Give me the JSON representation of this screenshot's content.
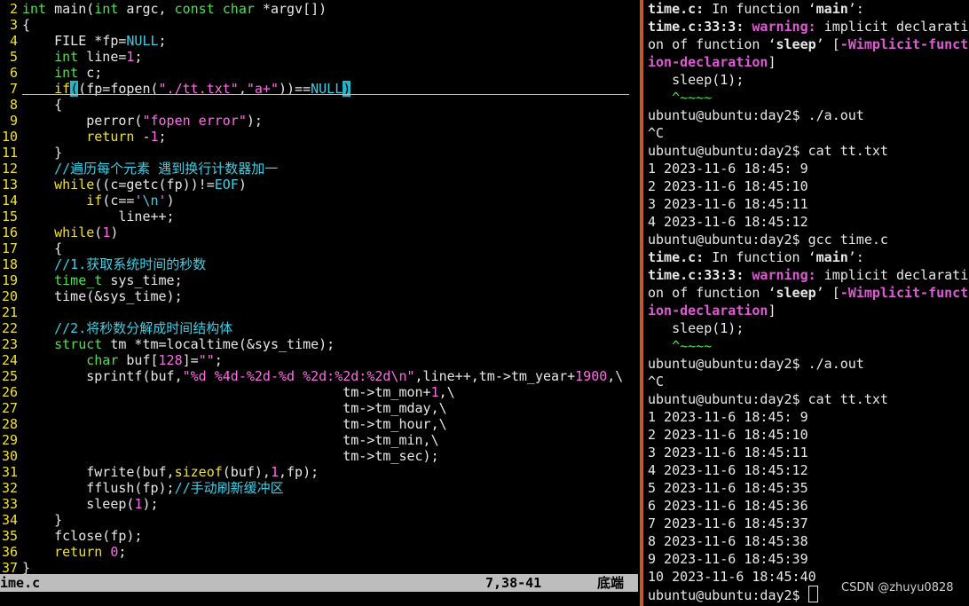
{
  "editor": {
    "file_name": "ime.c",
    "cursor_position": "7,38-41",
    "scroll_position": "底端"
  },
  "code_lines": [
    {
      "num": "2",
      "segs": [
        [
          "int",
          "t"
        ],
        [
          " main(",
          "x"
        ],
        [
          "int",
          "t"
        ],
        [
          " argc, ",
          "x"
        ],
        [
          "const",
          "t"
        ],
        [
          " ",
          "x"
        ],
        [
          "char",
          "t"
        ],
        [
          " *argv[])",
          "x"
        ]
      ]
    },
    {
      "num": "3",
      "segs": [
        [
          "{",
          "x"
        ]
      ]
    },
    {
      "num": "4",
      "segs": [
        [
          "    FILE *fp=",
          "x"
        ],
        [
          "NULL",
          "p"
        ],
        [
          ";",
          "x"
        ]
      ]
    },
    {
      "num": "5",
      "segs": [
        [
          "    ",
          "x"
        ],
        [
          "int",
          "t"
        ],
        [
          " line=",
          "x"
        ],
        [
          "1",
          "n"
        ],
        [
          ";",
          "x"
        ]
      ]
    },
    {
      "num": "6",
      "segs": [
        [
          "    ",
          "x"
        ],
        [
          "int",
          "t"
        ],
        [
          " c;",
          "x"
        ]
      ]
    },
    {
      "num": "7",
      "segs": [
        [
          "    ",
          "x"
        ],
        [
          "if",
          "k"
        ],
        [
          "(",
          "hl"
        ],
        [
          "(fp=fopen(",
          "x"
        ],
        [
          "\"./tt.txt\"",
          "s"
        ],
        [
          ",",
          "x"
        ],
        [
          "\"a+\"",
          "s"
        ],
        [
          "))==",
          "x"
        ],
        [
          "NULL",
          "p"
        ],
        [
          ")",
          "hl"
        ]
      ]
    },
    {
      "num": "8",
      "segs": [
        [
          "    {",
          "x"
        ]
      ]
    },
    {
      "num": "9",
      "segs": [
        [
          "        perror(",
          "x"
        ],
        [
          "\"fopen error\"",
          "s"
        ],
        [
          ");",
          "x"
        ]
      ]
    },
    {
      "num": "10",
      "segs": [
        [
          "        ",
          "x"
        ],
        [
          "return",
          "k"
        ],
        [
          " -",
          "x"
        ],
        [
          "1",
          "n"
        ],
        [
          ";",
          "x"
        ]
      ]
    },
    {
      "num": "11",
      "segs": [
        [
          "    }",
          "x"
        ]
      ]
    },
    {
      "num": "12",
      "segs": [
        [
          "    //遍历每个元素 遇到换行计数器加一",
          "c"
        ]
      ]
    },
    {
      "num": "13",
      "segs": [
        [
          "    ",
          "x"
        ],
        [
          "while",
          "k"
        ],
        [
          "((c=getc(fp))!=",
          "x"
        ],
        [
          "EOF",
          "p"
        ],
        [
          ")",
          "x"
        ]
      ]
    },
    {
      "num": "14",
      "segs": [
        [
          "        ",
          "x"
        ],
        [
          "if",
          "k"
        ],
        [
          "(c==",
          "x"
        ],
        [
          "'",
          "s"
        ],
        [
          "\\n",
          "p"
        ],
        [
          "'",
          "s"
        ],
        [
          ")",
          "x"
        ]
      ]
    },
    {
      "num": "15",
      "segs": [
        [
          "            line++;",
          "x"
        ]
      ]
    },
    {
      "num": "16",
      "segs": [
        [
          "    ",
          "x"
        ],
        [
          "while",
          "k"
        ],
        [
          "(",
          "x"
        ],
        [
          "1",
          "n"
        ],
        [
          ")",
          "x"
        ]
      ]
    },
    {
      "num": "17",
      "segs": [
        [
          "    {",
          "x"
        ]
      ]
    },
    {
      "num": "18",
      "segs": [
        [
          "    //1.获取系统时间的秒数",
          "c"
        ]
      ]
    },
    {
      "num": "19",
      "segs": [
        [
          "    ",
          "x"
        ],
        [
          "time_t",
          "t"
        ],
        [
          " sys_time;",
          "x"
        ]
      ]
    },
    {
      "num": "20",
      "segs": [
        [
          "    time(&sys_time);",
          "x"
        ]
      ]
    },
    {
      "num": "21",
      "segs": [
        [
          "",
          "x"
        ]
      ]
    },
    {
      "num": "22",
      "segs": [
        [
          "    //2.将秒数分解成时间结构体",
          "c"
        ]
      ]
    },
    {
      "num": "23",
      "segs": [
        [
          "    ",
          "x"
        ],
        [
          "struct",
          "t"
        ],
        [
          " tm *tm=localtime(&sys_time);",
          "x"
        ]
      ]
    },
    {
      "num": "24",
      "segs": [
        [
          "        ",
          "x"
        ],
        [
          "char",
          "t"
        ],
        [
          " buf[",
          "x"
        ],
        [
          "128",
          "n"
        ],
        [
          "]=",
          "x"
        ],
        [
          "\"\"",
          "s"
        ],
        [
          ";",
          "x"
        ]
      ]
    },
    {
      "num": "25",
      "segs": [
        [
          "        sprintf(buf,",
          "x"
        ],
        [
          "\"%d %4d-%2d-%d %2d:%2d:%2d\\n\"",
          "s"
        ],
        [
          ",line++,tm->tm_year+",
          "x"
        ],
        [
          "1900",
          "n"
        ],
        [
          ",\\",
          "x"
        ]
      ]
    },
    {
      "num": "26",
      "segs": [
        [
          "                                        tm->tm_mon+",
          "x"
        ],
        [
          "1",
          "n"
        ],
        [
          ",\\",
          "x"
        ]
      ]
    },
    {
      "num": "27",
      "segs": [
        [
          "                                        tm->tm_mday,\\",
          "x"
        ]
      ]
    },
    {
      "num": "28",
      "segs": [
        [
          "                                        tm->tm_hour,\\",
          "x"
        ]
      ]
    },
    {
      "num": "29",
      "segs": [
        [
          "                                        tm->tm_min,\\",
          "x"
        ]
      ]
    },
    {
      "num": "30",
      "segs": [
        [
          "                                        tm->tm_sec);",
          "x"
        ]
      ]
    },
    {
      "num": "31",
      "segs": [
        [
          "        fwrite(buf,",
          "x"
        ],
        [
          "sizeof",
          "k"
        ],
        [
          "(buf),",
          "x"
        ],
        [
          "1",
          "n"
        ],
        [
          ",fp);",
          "x"
        ]
      ]
    },
    {
      "num": "32",
      "segs": [
        [
          "        fflush(fp);",
          "x"
        ],
        [
          "//手动刷新缓冲区",
          "c"
        ]
      ]
    },
    {
      "num": "33",
      "segs": [
        [
          "        sleep(",
          "x"
        ],
        [
          "1",
          "n"
        ],
        [
          ");",
          "x"
        ]
      ]
    },
    {
      "num": "34",
      "segs": [
        [
          "    }",
          "x"
        ]
      ]
    },
    {
      "num": "35",
      "segs": [
        [
          "    fclose(fp);",
          "x"
        ]
      ]
    },
    {
      "num": "36",
      "segs": [
        [
          "    ",
          "x"
        ],
        [
          "return",
          "k"
        ],
        [
          " ",
          "x"
        ],
        [
          "0",
          "n"
        ],
        [
          ";",
          "x"
        ]
      ]
    },
    {
      "num": "37",
      "segs": [
        [
          "}",
          "x"
        ]
      ]
    }
  ],
  "terminal_lines": [
    [
      [
        "time.c:",
        "b"
      ],
      [
        " In function ‘",
        "x"
      ],
      [
        "main",
        "b"
      ],
      [
        "’:",
        "x"
      ]
    ],
    [
      [
        "time.c:33:3: ",
        "b"
      ],
      [
        "warning:",
        "mag"
      ],
      [
        " implicit declarati",
        "x"
      ]
    ],
    [
      [
        "on of function ‘",
        "x"
      ],
      [
        "sleep",
        "b"
      ],
      [
        "’ [",
        "x"
      ],
      [
        "-Wimplicit-funct",
        "mag"
      ]
    ],
    [
      [
        "ion-declaration",
        "mag"
      ],
      [
        "]",
        "x"
      ]
    ],
    [
      [
        "   sleep(1);",
        "x"
      ]
    ],
    [
      [
        "   ^~~~~",
        "gr"
      ]
    ],
    [
      [
        "ubuntu@ubuntu:day2$ ./a.out",
        "x"
      ]
    ],
    [
      [
        "^C",
        "x"
      ]
    ],
    [
      [
        "ubuntu@ubuntu:day2$ cat tt.txt",
        "x"
      ]
    ],
    [
      [
        "1 2023-11-6 18:45: 9",
        "x"
      ]
    ],
    [
      [
        "2 2023-11-6 18:45:10",
        "x"
      ]
    ],
    [
      [
        "3 2023-11-6 18:45:11",
        "x"
      ]
    ],
    [
      [
        "4 2023-11-6 18:45:12",
        "x"
      ]
    ],
    [
      [
        "ubuntu@ubuntu:day2$ gcc time.c",
        "x"
      ]
    ],
    [
      [
        "time.c:",
        "b"
      ],
      [
        " In function ‘",
        "x"
      ],
      [
        "main",
        "b"
      ],
      [
        "’:",
        "x"
      ]
    ],
    [
      [
        "time.c:33:3: ",
        "b"
      ],
      [
        "warning:",
        "mag"
      ],
      [
        " implicit declarati",
        "x"
      ]
    ],
    [
      [
        "on of function ‘",
        "x"
      ],
      [
        "sleep",
        "b"
      ],
      [
        "’ [",
        "x"
      ],
      [
        "-Wimplicit-funct",
        "mag"
      ]
    ],
    [
      [
        "ion-declaration",
        "mag"
      ],
      [
        "]",
        "x"
      ]
    ],
    [
      [
        "   sleep(1);",
        "x"
      ]
    ],
    [
      [
        "   ^~~~~",
        "gr"
      ]
    ],
    [
      [
        "ubuntu@ubuntu:day2$ ./a.out",
        "x"
      ]
    ],
    [
      [
        "^C",
        "x"
      ]
    ],
    [
      [
        "ubuntu@ubuntu:day2$ cat tt.txt",
        "x"
      ]
    ],
    [
      [
        "1 2023-11-6 18:45: 9",
        "x"
      ]
    ],
    [
      [
        "2 2023-11-6 18:45:10",
        "x"
      ]
    ],
    [
      [
        "3 2023-11-6 18:45:11",
        "x"
      ]
    ],
    [
      [
        "4 2023-11-6 18:45:12",
        "x"
      ]
    ],
    [
      [
        "5 2023-11-6 18:45:35",
        "x"
      ]
    ],
    [
      [
        "6 2023-11-6 18:45:36",
        "x"
      ]
    ],
    [
      [
        "7 2023-11-6 18:45:37",
        "x"
      ]
    ],
    [
      [
        "8 2023-11-6 18:45:38",
        "x"
      ]
    ],
    [
      [
        "9 2023-11-6 18:45:39",
        "x"
      ]
    ],
    [
      [
        "10 2023-11-6 18:45:40",
        "x"
      ]
    ],
    [
      [
        "ubuntu@ubuntu:day2$ ",
        "x"
      ]
    ]
  ],
  "watermark": "CSDN @zhuyu0828",
  "colors": {
    "divider": "#c05a2b",
    "statusbar": "#bdbdbd",
    "line_number": "#f0e033"
  }
}
